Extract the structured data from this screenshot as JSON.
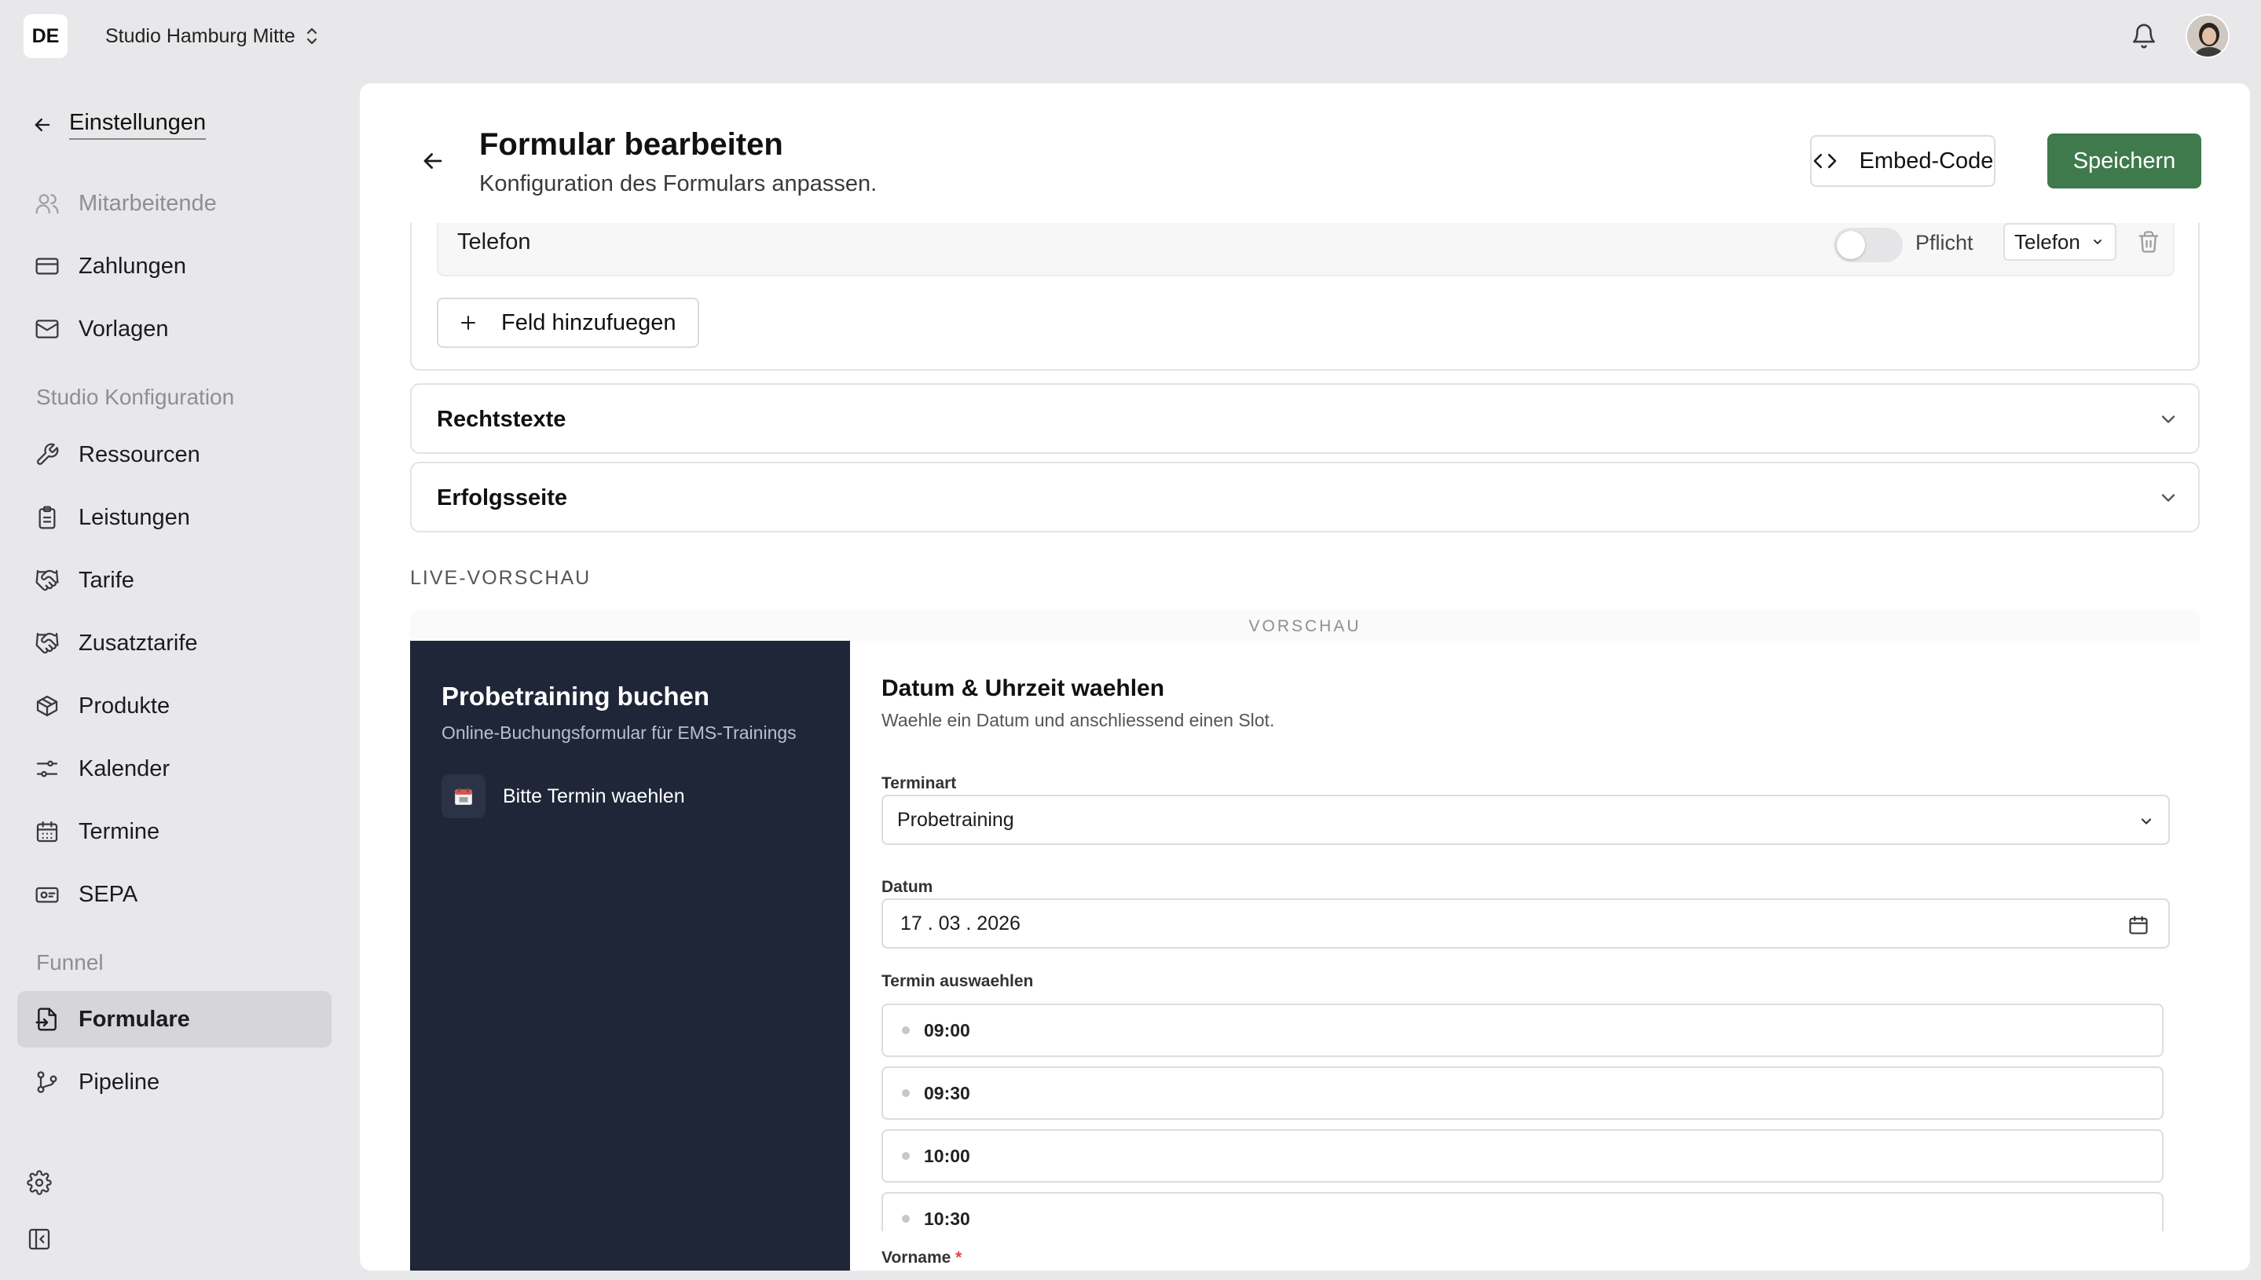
{
  "topbar": {
    "locale": "DE",
    "studio_name": "Studio Hamburg Mitte"
  },
  "sidebar": {
    "back_label": "Einstellungen",
    "top_items": [
      {
        "label": "Mitarbeitende",
        "icon": "users-icon",
        "muted": true
      },
      {
        "label": "Zahlungen",
        "icon": "credit-card-icon"
      },
      {
        "label": "Vorlagen",
        "icon": "mail-icon"
      }
    ],
    "section_studio": "Studio Konfiguration",
    "studio_items": [
      {
        "label": "Ressourcen",
        "icon": "wrench-icon"
      },
      {
        "label": "Leistungen",
        "icon": "clipboard-icon"
      },
      {
        "label": "Tarife",
        "icon": "handshake-icon"
      },
      {
        "label": "Zusatztarife",
        "icon": "handshake-icon"
      },
      {
        "label": "Produkte",
        "icon": "package-icon"
      },
      {
        "label": "Kalender",
        "icon": "sliders-icon"
      },
      {
        "label": "Termine",
        "icon": "calendar-icon"
      },
      {
        "label": "SEPA",
        "icon": "sepa-icon"
      }
    ],
    "section_funnel": "Funnel",
    "funnel_items": [
      {
        "label": "Formulare",
        "icon": "file-form-icon",
        "active": true
      },
      {
        "label": "Pipeline",
        "icon": "pipeline-icon"
      }
    ]
  },
  "header": {
    "title": "Formular bearbeiten",
    "subtitle": "Konfiguration des Formulars anpassen.",
    "embed_label": "Embed-Code",
    "save_label": "Speichern"
  },
  "fields": {
    "rows": [
      {
        "name": "Telefon",
        "required_label": "Pflicht",
        "required": false,
        "type": "Telefon"
      }
    ],
    "add_label": "Feld hinzufuegen"
  },
  "accordions": [
    {
      "title": "Rechtstexte"
    },
    {
      "title": "Erfolgsseite"
    }
  ],
  "preview": {
    "section_label": "LIVE-VORSCHAU",
    "tag": "VORSCHAU",
    "side": {
      "title": "Probetraining buchen",
      "subtitle": "Online-Buchungsformular für EMS-Trainings",
      "step_label": "Bitte Termin waehlen"
    },
    "form": {
      "heading": "Datum & Uhrzeit waehlen",
      "description": "Waehle ein Datum und anschliessend einen Slot.",
      "type_label": "Terminart",
      "type_value": "Probetraining",
      "date_label": "Datum",
      "date_value": "17 . 03 . 2026",
      "slots_label": "Termin auswaehlen",
      "slots": [
        "09:00",
        "09:30",
        "10:00",
        "10:30"
      ],
      "firstname_label": "Vorname",
      "required_mark": "*"
    }
  },
  "colors": {
    "primary": "#3f7a4d",
    "preview_sidebar": "#1e2637",
    "app_background": "#e8e8ea"
  }
}
